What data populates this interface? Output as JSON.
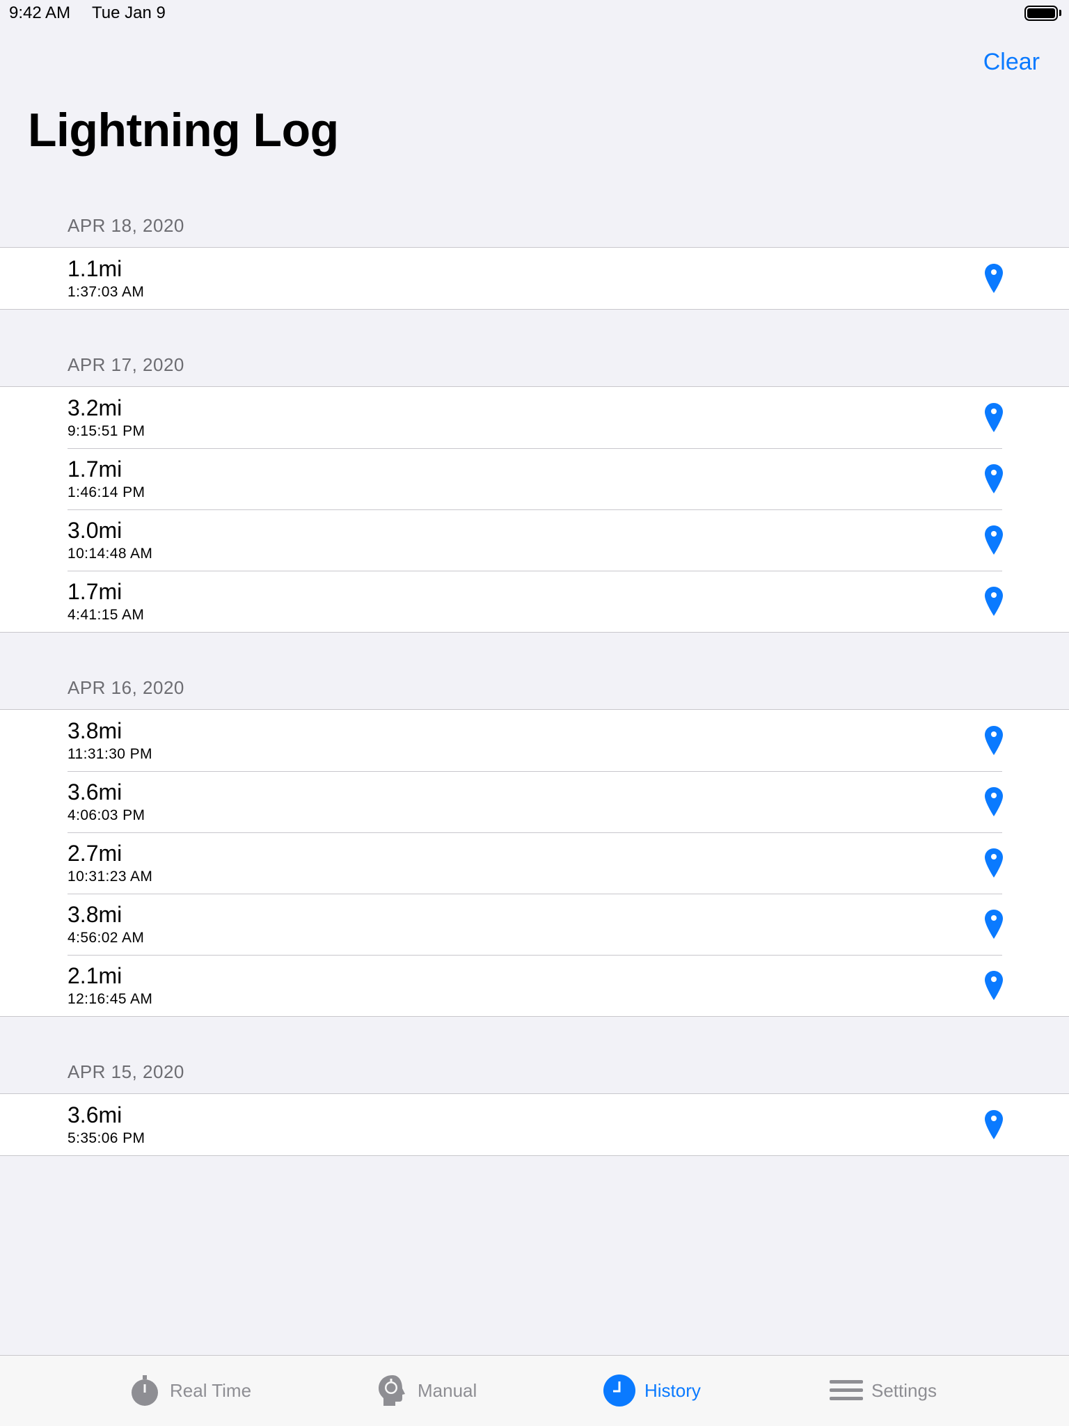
{
  "status": {
    "time": "9:42 AM",
    "date": "Tue Jan 9"
  },
  "nav": {
    "clear_label": "Clear",
    "title": "Lightning Log"
  },
  "sections": [
    {
      "date": "APR 18, 2020",
      "entries": [
        {
          "distance": "1.1mi",
          "time": "1:37:03 AM"
        }
      ]
    },
    {
      "date": "APR 17, 2020",
      "entries": [
        {
          "distance": "3.2mi",
          "time": "9:15:51 PM"
        },
        {
          "distance": "1.7mi",
          "time": "1:46:14 PM"
        },
        {
          "distance": "3.0mi",
          "time": "10:14:48 AM"
        },
        {
          "distance": "1.7mi",
          "time": "4:41:15 AM"
        }
      ]
    },
    {
      "date": "APR 16, 2020",
      "entries": [
        {
          "distance": "3.8mi",
          "time": "11:31:30 PM"
        },
        {
          "distance": "3.6mi",
          "time": "4:06:03 PM"
        },
        {
          "distance": "2.7mi",
          "time": "10:31:23 AM"
        },
        {
          "distance": "3.8mi",
          "time": "4:56:02 AM"
        },
        {
          "distance": "2.1mi",
          "time": "12:16:45 AM"
        }
      ]
    },
    {
      "date": "APR 15, 2020",
      "entries": [
        {
          "distance": "3.6mi",
          "time": "5:35:06 PM"
        }
      ]
    }
  ],
  "row_icon": "location-pin-icon",
  "tabs": [
    {
      "label": "Real Time",
      "icon": "stopwatch-icon",
      "active": false
    },
    {
      "label": "Manual",
      "icon": "head-stopwatch-icon",
      "active": false
    },
    {
      "label": "History",
      "icon": "clock-icon",
      "active": true
    },
    {
      "label": "Settings",
      "icon": "hamburger-menu-icon",
      "active": false
    }
  ],
  "colors": {
    "accent": "#0a7aff",
    "background": "#f2f2f7",
    "inactive": "#8e8e93"
  }
}
